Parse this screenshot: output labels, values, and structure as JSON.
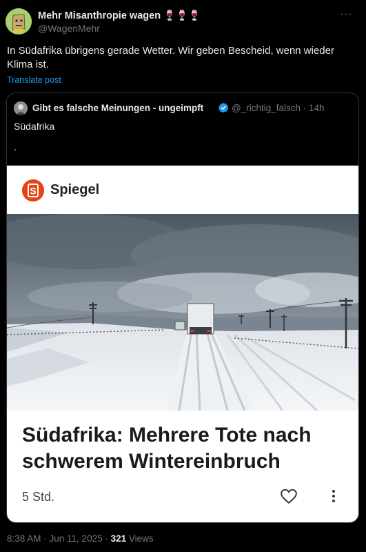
{
  "post": {
    "author_name": "Mehr Misanthropie wagen 🍷🍷🍷",
    "author_handle": "@WagenMehr",
    "more_label": "···",
    "text": "In Südafrika übrigens gerade Wetter. Wir geben Bescheid, wenn wieder Klima ist.",
    "translate_label": "Translate post",
    "time": "8:38 AM · Jun 11, 2025 · ",
    "views_count": "321",
    "views_label": " Views"
  },
  "quote": {
    "author_name": "Gibt es falsche Meinungen - ungeimpft",
    "author_handle": "@_richtig_falsch · 14h",
    "text_line1": "Südafrika",
    "text_line2": "."
  },
  "card": {
    "source": "Spiegel",
    "logo_letter": "S",
    "headline": "Südafrika: Mehrere Tote nach schwerem Wintereinbruch",
    "time": "5 Std."
  },
  "icons": {
    "verified": "verified-badge-icon",
    "heart": "heart-icon",
    "more": "more-vertical-icon"
  },
  "colors": {
    "link": "#1d9bf0",
    "spiegel": "#e64415"
  }
}
